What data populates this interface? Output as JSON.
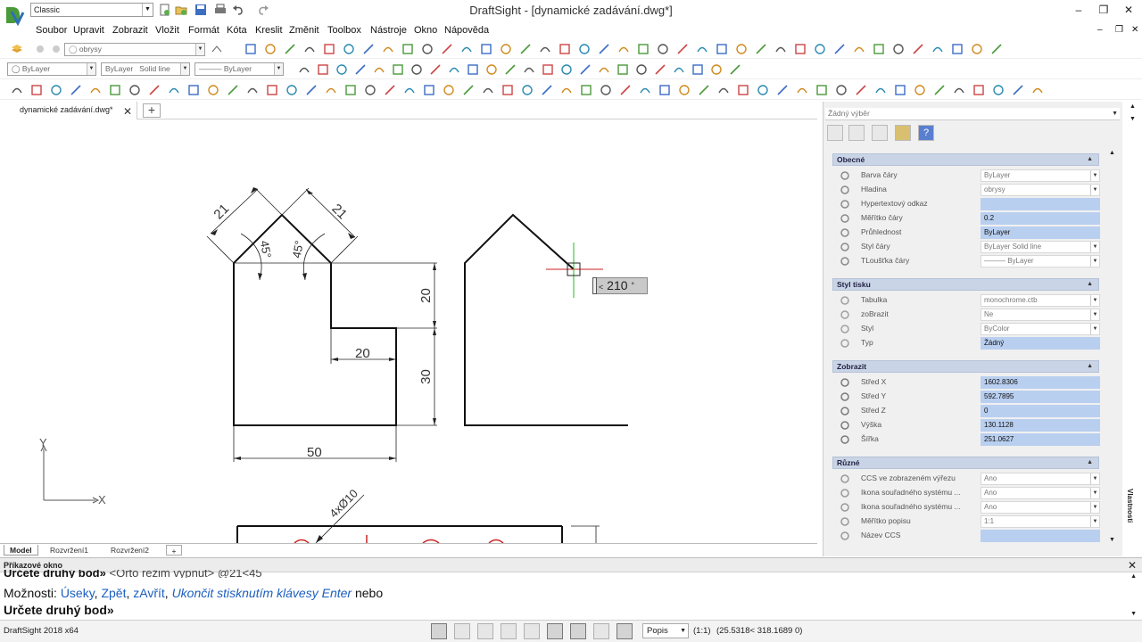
{
  "app": {
    "title": "DraftSight - [dynamické zadávání.dwg*]",
    "workspace": "Classic",
    "version": "DraftSight 2018 x64"
  },
  "menu": {
    "items": [
      "Soubor",
      "Upravit",
      "Zobrazit",
      "Vložit",
      "Formát",
      "Kóta",
      "Kreslit",
      "Změnit",
      "Toolbox",
      "Nástroje",
      "Okno",
      "Nápověda"
    ]
  },
  "toolbar": {
    "layer_combo": "obrysy",
    "color_combo": "ByLayer",
    "linestyle_combo": "ByLayer",
    "linestyle_value": "Solid line",
    "lineweight_combo": "ByLayer"
  },
  "tabs": {
    "document": "dynamické zadávání.dwg*",
    "layouts": [
      "Model",
      "Rozvržení1",
      "Rozvržení2"
    ]
  },
  "drawing": {
    "dim_21_left": "21",
    "dim_21_right": "21",
    "dim_45_left": "45°",
    "dim_45_right": "45°",
    "dim_20_vertical": "20",
    "dim_20_horizontal": "20",
    "dim_30": "30",
    "dim_50": "50",
    "dim_hole": "4xØ10",
    "ucs_x": "X",
    "ucs_y": "Y",
    "dynamic_input": {
      "prefix": "<",
      "value": "210",
      "unit": "°"
    }
  },
  "properties": {
    "selector": "Žádný výběr",
    "sections": {
      "general": "Obecné",
      "print_style": "Styl tisku",
      "view": "Zobrazit",
      "misc": "Různé"
    },
    "general_rows": [
      {
        "icon": "color-wheel-icon",
        "label": "Barva čáry",
        "value": "ByLayer",
        "dropdown": true,
        "edit": false
      },
      {
        "icon": "layers-icon",
        "label": "Hladina",
        "value": "obrysy",
        "dropdown": true,
        "edit": false
      },
      {
        "icon": "globe-link-icon",
        "label": "Hypertextový odkaz",
        "value": "",
        "dropdown": false,
        "edit": true
      },
      {
        "icon": "linescale-icon",
        "label": "Měřítko čáry",
        "value": "0.2",
        "dropdown": false,
        "edit": true
      },
      {
        "icon": "transparency-icon",
        "label": "Průhlednost",
        "value": "ByLayer",
        "dropdown": false,
        "edit": true
      },
      {
        "icon": "linestyle-icon",
        "label": "Styl čáry",
        "value": "ByLayer     Solid line",
        "dropdown": true,
        "edit": false
      },
      {
        "icon": "lineweight-icon",
        "label": "TLoušťka čáry",
        "value": "——— ByLayer",
        "dropdown": true,
        "edit": false
      }
    ],
    "print_rows": [
      {
        "icon": "table-icon",
        "label": "Tabulka",
        "value": "monochrome.ctb",
        "dropdown": true,
        "edit": false
      },
      {
        "icon": "display-icon",
        "label": "zoBrazit",
        "value": "Ne",
        "dropdown": true,
        "edit": false
      },
      {
        "icon": "style-icon",
        "label": "Styl",
        "value": "ByColor",
        "dropdown": true,
        "edit": false
      },
      {
        "icon": "type-icon",
        "label": "Typ",
        "value": "Žádný",
        "dropdown": false,
        "edit": true
      }
    ],
    "view_rows": [
      {
        "icon": "center-x-icon",
        "label": "Střed X",
        "value": "1602.8306",
        "dropdown": false,
        "edit": true
      },
      {
        "icon": "center-y-icon",
        "label": "Střed Y",
        "value": "592.7895",
        "dropdown": false,
        "edit": true
      },
      {
        "icon": "center-z-icon",
        "label": "Střed Z",
        "value": "0",
        "dropdown": false,
        "edit": true
      },
      {
        "icon": "height-icon",
        "label": "Výška",
        "value": "130.1128",
        "dropdown": false,
        "edit": true
      },
      {
        "icon": "width-icon",
        "label": "Šířka",
        "value": "251.0627",
        "dropdown": false,
        "edit": true
      }
    ],
    "misc_rows": [
      {
        "icon": "ccs-icon",
        "label": "CCS ve zobrazeném výřezu",
        "value": "Ano",
        "dropdown": true,
        "edit": false
      },
      {
        "icon": "ucs-icon",
        "label": "Ikona souřadného systému ...",
        "value": "Ano",
        "dropdown": true,
        "edit": false
      },
      {
        "icon": "ucs-origin-icon",
        "label": "Ikona souřadného systému ...",
        "value": "Ano",
        "dropdown": true,
        "edit": false
      },
      {
        "icon": "annotation-scale-icon",
        "label": "Měřítko popisu",
        "value": "1:1",
        "dropdown": true,
        "edit": false
      },
      {
        "icon": "ccs-name-icon",
        "label": "Název CCS",
        "value": "",
        "dropdown": false,
        "edit": true
      }
    ],
    "side_tab": "Vlastnosti"
  },
  "command": {
    "title": "Příkazové okno",
    "history_bold": "Určete druhý bod»",
    "history_gray": "<Orto režim vypnut> @21<45",
    "options_prefix": "Možnosti:",
    "opt_1": "Úseky",
    "opt_2": "Zpět",
    "opt_3": "zAvřít",
    "opt_4": "Ukončit stisknutím klávesy Enter",
    "options_suffix": "nebo",
    "prompt": "Určete druhý bod»"
  },
  "status": {
    "annotation": "Popis",
    "scale": "(1:1)",
    "coords": "(25.5318< 318.1689 0)"
  }
}
